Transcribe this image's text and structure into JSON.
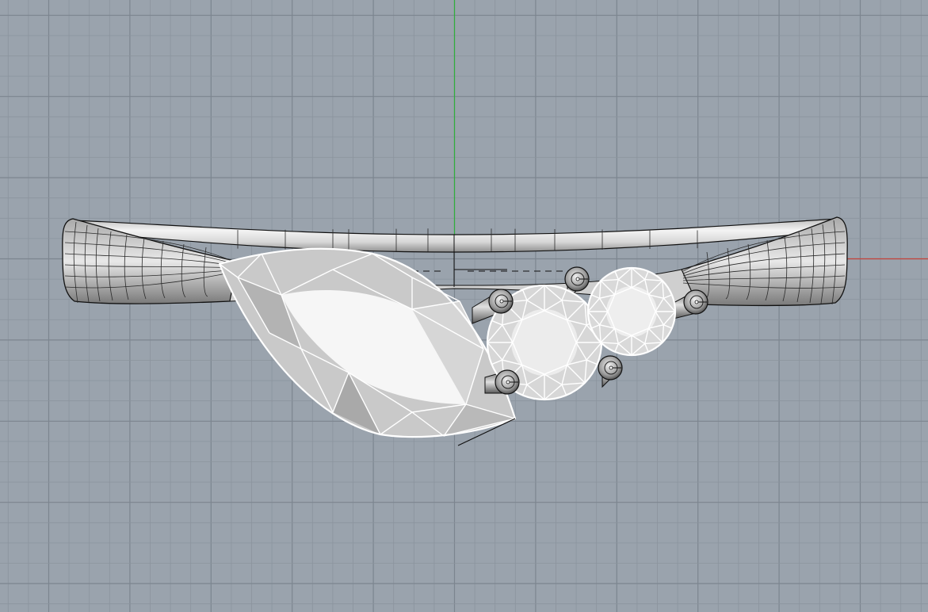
{
  "viewport": {
    "view_type": "Front",
    "display_mode": "shaded-wireframe",
    "background_color": "#9aa3ad",
    "grid_visible": true,
    "grid_minor_color": "#8b949e",
    "grid_major_color": "#7c858f",
    "y_axis_color": "#2fae3b",
    "x_axis_color": "#c6423b"
  },
  "model": {
    "object": "ring-with-stones",
    "band_color": "#d8d8d8",
    "gem_color": "#f2f2f2",
    "gem_edge_color": "#ffffff",
    "stones": [
      {
        "name": "marquise-stone",
        "cut": "marquise"
      },
      {
        "name": "round-stone-large",
        "cut": "round"
      },
      {
        "name": "round-stone-small",
        "cut": "round"
      }
    ],
    "prong_count": 6
  }
}
